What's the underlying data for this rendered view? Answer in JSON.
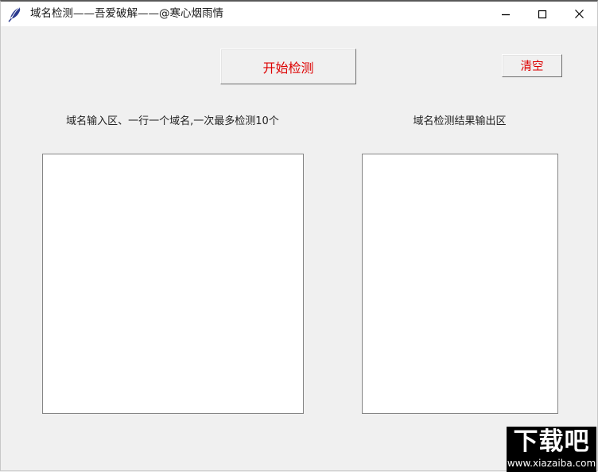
{
  "window": {
    "title": "域名检测——吾爱破解——@寒心烟雨情",
    "icon": "feather-quill-icon",
    "background_color": "#f0f0f0",
    "titlebar_color": "#ffffff",
    "controls": {
      "minimize": "—",
      "maximize": "☐",
      "close": "✕"
    }
  },
  "toolbar": {
    "start_button_label": "开始检测",
    "clear_button_label": "清空",
    "button_text_color": "#dd0000"
  },
  "panels": {
    "input": {
      "label": "域名输入区、一行一个域名,一次最多检测10个",
      "value": "",
      "placeholder": ""
    },
    "output": {
      "label": "域名检测结果输出区",
      "value": "",
      "placeholder": ""
    }
  },
  "watermark": {
    "logo_text": "下载吧",
    "url_text": "www.xiazaiba.com",
    "background_color": "#000000",
    "text_color": "#ffffff"
  }
}
